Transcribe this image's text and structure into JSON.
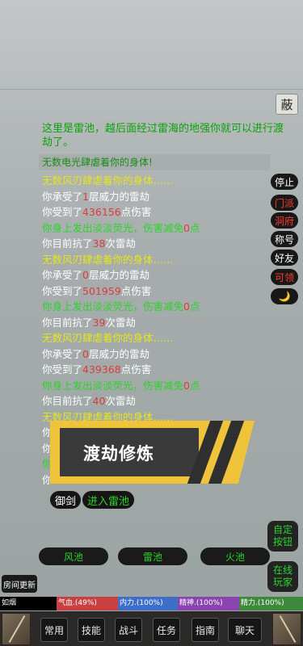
{
  "side_button": "蔽",
  "intro_text": "这里是雷池，越后面经过雷海的地强你就可以进行渡劫了。",
  "highlight_line": "无数电光肆虐着你的身体!",
  "log": [
    {
      "parts": [
        {
          "t": "无数风刃肆虐着你的身体……",
          "c": "yellow"
        }
      ]
    },
    {
      "parts": [
        {
          "t": "你承受了",
          "c": "white"
        },
        {
          "t": "1",
          "c": "red"
        },
        {
          "t": "层威力的雷劫",
          "c": "white"
        }
      ]
    },
    {
      "parts": [
        {
          "t": "你受到了",
          "c": "white"
        },
        {
          "t": "436156",
          "c": "red"
        },
        {
          "t": "点伤害",
          "c": "white"
        }
      ]
    },
    {
      "parts": [
        {
          "t": "你身上发出淡淡荧光，伤害减免",
          "c": "green"
        },
        {
          "t": "0",
          "c": "red"
        },
        {
          "t": "点",
          "c": "green"
        }
      ]
    },
    {
      "parts": [
        {
          "t": "你目前抗了",
          "c": "white"
        },
        {
          "t": "38",
          "c": "red"
        },
        {
          "t": "次雷劫",
          "c": "white"
        }
      ]
    },
    {
      "parts": [
        {
          "t": "无数风刃肆虐着你的身体……",
          "c": "yellow"
        }
      ]
    },
    {
      "parts": [
        {
          "t": "你承受了",
          "c": "white"
        },
        {
          "t": "0",
          "c": "red"
        },
        {
          "t": "层威力的雷劫",
          "c": "white"
        }
      ]
    },
    {
      "parts": [
        {
          "t": "你受到了",
          "c": "white"
        },
        {
          "t": "501959",
          "c": "red"
        },
        {
          "t": "点伤害",
          "c": "white"
        }
      ]
    },
    {
      "parts": [
        {
          "t": "你身上发出淡淡荧光，伤害减免",
          "c": "green"
        },
        {
          "t": "0",
          "c": "red"
        },
        {
          "t": "点",
          "c": "green"
        }
      ]
    },
    {
      "parts": [
        {
          "t": "你目前抗了",
          "c": "white"
        },
        {
          "t": "39",
          "c": "red"
        },
        {
          "t": "次雷劫",
          "c": "white"
        }
      ]
    },
    {
      "parts": [
        {
          "t": "无数风刃肆虐着你的身体……",
          "c": "yellow"
        }
      ]
    },
    {
      "parts": [
        {
          "t": "你承受了",
          "c": "white"
        },
        {
          "t": "0",
          "c": "red"
        },
        {
          "t": "层威力的雷劫",
          "c": "white"
        }
      ]
    },
    {
      "parts": [
        {
          "t": "你受到了",
          "c": "white"
        },
        {
          "t": "439368",
          "c": "red"
        },
        {
          "t": "点伤害",
          "c": "white"
        }
      ]
    },
    {
      "parts": [
        {
          "t": "你身上发出淡淡荧光，伤害减免",
          "c": "green"
        },
        {
          "t": "0",
          "c": "red"
        },
        {
          "t": "点",
          "c": "green"
        }
      ]
    },
    {
      "parts": [
        {
          "t": "你目前抗了",
          "c": "white"
        },
        {
          "t": "40",
          "c": "red"
        },
        {
          "t": "次雷劫",
          "c": "white"
        }
      ]
    },
    {
      "parts": [
        {
          "t": "无数风刃肆虐着你的身体……",
          "c": "yellow"
        }
      ]
    },
    {
      "parts": [
        {
          "t": "你",
          "c": "white"
        }
      ]
    },
    {
      "parts": [
        {
          "t": "你",
          "c": "white"
        }
      ]
    },
    {
      "parts": [
        {
          "t": "你",
          "c": "green"
        }
      ]
    },
    {
      "parts": [
        {
          "t": "你",
          "c": "white"
        }
      ]
    }
  ],
  "right_menu": [
    {
      "label": "停止",
      "color": "white"
    },
    {
      "label": "门派",
      "color": "red"
    },
    {
      "label": "洞府",
      "color": "red"
    },
    {
      "label": "称号",
      "color": "white"
    },
    {
      "label": "好友",
      "color": "white"
    },
    {
      "label": "可领",
      "color": "red"
    },
    {
      "label": "🌙",
      "color": "white"
    }
  ],
  "banner_title": "渡劫修炼",
  "fly_sword": "御剑",
  "enter_pool": "进入雷池",
  "pools": [
    "风池",
    "雷池",
    "火池"
  ],
  "custom_button": "自定按钮",
  "online_players": "在线玩家",
  "room_update": "房间更新",
  "stats": [
    {
      "label": "如烟",
      "color": "#000000"
    },
    {
      "label": "气血.(49%)",
      "color": "#c84040"
    },
    {
      "label": "内力.(100%)",
      "color": "#3d6fc8"
    },
    {
      "label": "精神.(100%)",
      "color": "#8a44b0"
    },
    {
      "label": "精力.(100%)",
      "color": "#3d8a3d"
    }
  ],
  "nav": [
    "常用",
    "技能",
    "战斗",
    "任务",
    "指南",
    "聊天"
  ]
}
